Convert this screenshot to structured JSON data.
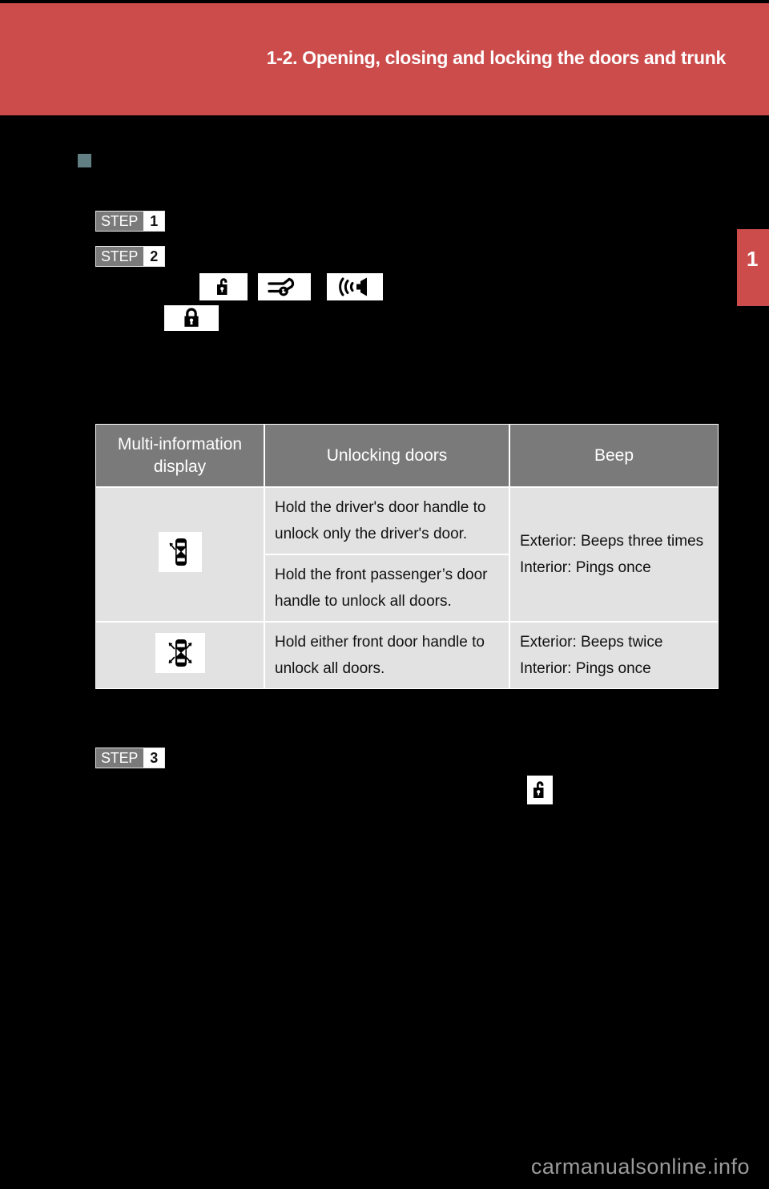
{
  "header": {
    "title": "1-2. Opening, closing and locking the doors and trunk",
    "banner_color": "#cc4c4c"
  },
  "chapter_tab": {
    "number": "1",
    "color": "#cc4c4c"
  },
  "section": {
    "bullet_color": "#628084",
    "heading": ""
  },
  "steps": [
    {
      "word": "STEP",
      "number": "1",
      "text": ""
    },
    {
      "word": "STEP",
      "number": "2",
      "text": ""
    },
    {
      "word": "STEP",
      "number": "3",
      "text": ""
    }
  ],
  "step2_note": "",
  "glyphs": {
    "unlock_1": "unlock-icon",
    "key_trunk": "key-trunk-icon",
    "sound": "sound-icon",
    "lock": "lock-icon",
    "unlock_2": "unlock-icon"
  },
  "table": {
    "headers": [
      "Multi-information display",
      "Unlocking doors",
      "Beep"
    ],
    "rows": [
      {
        "icon": "car-driver-door-unlock-icon",
        "actions": [
          "Hold the driver's door handle to unlock only the driver's door.",
          "Hold the front passenger’s door handle to unlock all doors."
        ],
        "beep": "Exterior: Beeps three times\nInterior: Pings once"
      },
      {
        "icon": "car-all-doors-unlock-icon",
        "actions": [
          "Hold either front door handle to unlock all doors."
        ],
        "beep": "Exterior: Beeps twice\nInterior: Pings once"
      }
    ]
  },
  "watermark": "carmanualsonline.info"
}
